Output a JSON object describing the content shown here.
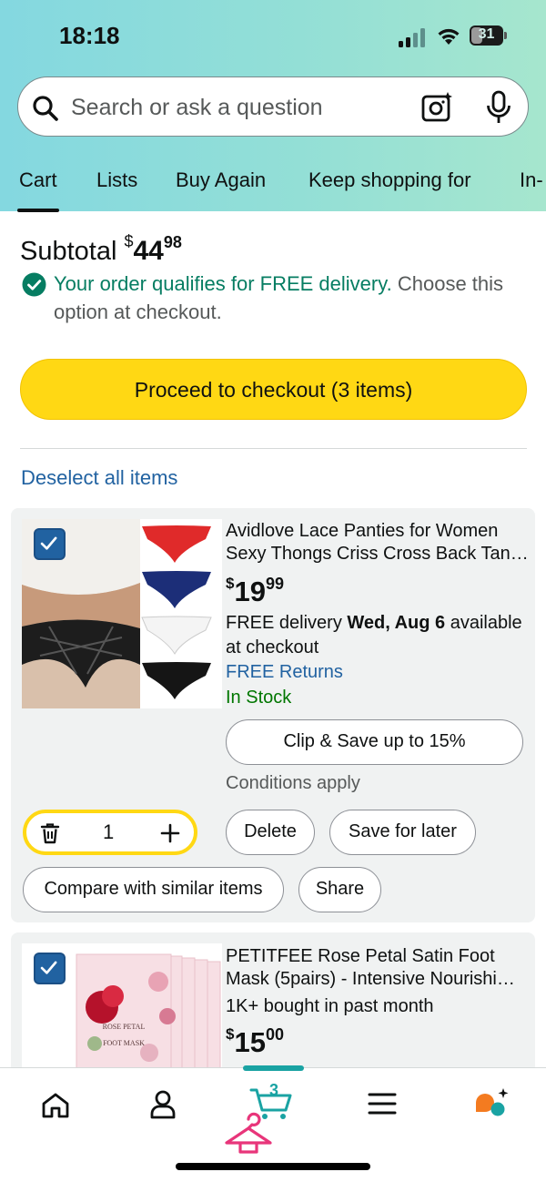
{
  "status_bar": {
    "time": "18:18",
    "battery": "31"
  },
  "search": {
    "placeholder": "Search or ask a question"
  },
  "tabs": [
    "Cart",
    "Lists",
    "Buy Again",
    "Keep shopping for",
    "In-"
  ],
  "cart": {
    "subtotal_label": "Subtotal",
    "subtotal_currency": "$",
    "subtotal_dollars": "44",
    "subtotal_cents": "98",
    "free_delivery_highlight": "Your order qualifies for FREE delivery.",
    "free_delivery_rest_1": "Choose this",
    "free_delivery_rest_2": "option at checkout.",
    "checkout_button": "Proceed to checkout (3 items)",
    "deselect_all": "Deselect all items"
  },
  "items": [
    {
      "title_line1": "Avidlove Lace Panties for Women",
      "title_line2": "Sexy Thongs Criss Cross Back Tan…",
      "price_currency": "$",
      "price_dollars": "19",
      "price_cents": "99",
      "delivery_prefix": "FREE delivery",
      "delivery_date": "Wed, Aug 6",
      "delivery_suffix": "available",
      "delivery_line2": "at checkout",
      "returns": "FREE Returns",
      "stock": "In Stock",
      "coupon_button": "Clip & Save up to 15%",
      "conditions": "Conditions apply",
      "quantity": "1",
      "delete_button": "Delete",
      "save_for_later_button": "Save for later",
      "compare_button": "Compare with similar items",
      "share_button": "Share",
      "swatch_colors": [
        "#e02a2a",
        "#1c2e78",
        "#f4f4f4",
        "#151515"
      ]
    },
    {
      "title_line1": "PETITFEE Rose Petal Satin Foot",
      "title_line2": "Mask (5pairs) - Intensive Nourishi…",
      "social_proof": "1K+ bought in past month",
      "price_currency": "$",
      "price_dollars": "15",
      "price_cents": "00",
      "package_text_1": "ROSE PETAL",
      "package_text_2": "FOOT MASK"
    }
  ],
  "bottom_nav": {
    "items": [
      "home-icon",
      "account-icon",
      "cart-icon",
      "menu-icon",
      "rufus-icon"
    ],
    "cart_count": "3"
  },
  "colors": {
    "accent_yellow": "#ffd814",
    "link_blue": "#2162a1",
    "success_green": "#067d62",
    "teal": "#1aa3a3"
  }
}
